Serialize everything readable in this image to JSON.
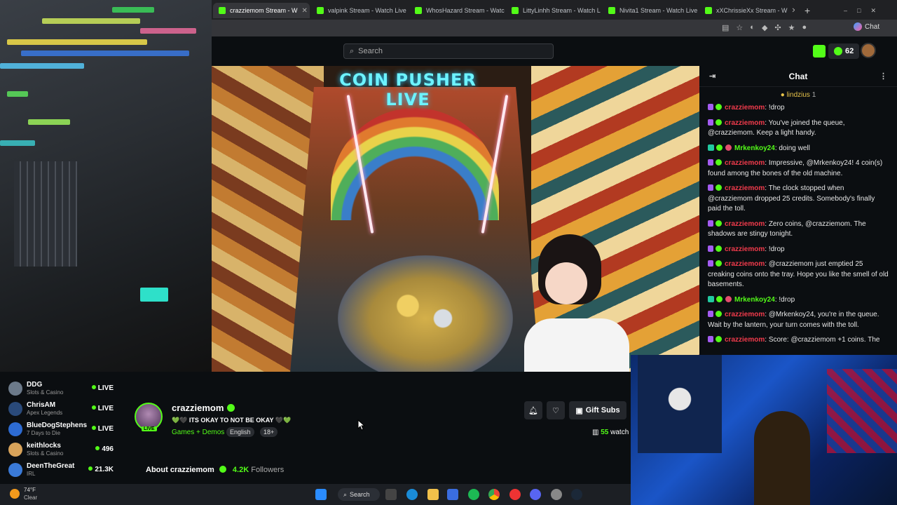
{
  "browser": {
    "tabs": [
      {
        "label": "crazziemom Stream - W",
        "active": true
      },
      {
        "label": "valpink Stream - Watch Live"
      },
      {
        "label": "WhosHazard Stream - Watc"
      },
      {
        "label": "LittyLinhh Stream - Watch L"
      },
      {
        "label": "Nivita1 Stream - Watch Live"
      },
      {
        "label": "xXChrissieXx Stream - W"
      }
    ],
    "chat_button": "Chat"
  },
  "header": {
    "search_placeholder": "Search",
    "kicks_count": "62"
  },
  "video": {
    "overlay_title": "COIN PUSHER LIVE"
  },
  "chat": {
    "title": "Chat",
    "pinned_user": "lindzius",
    "pinned_count": "1",
    "messages": [
      {
        "user": "crazziemom",
        "color": "#f23b4c",
        "text": "!drop"
      },
      {
        "user": "crazziemom",
        "color": "#f23b4c",
        "text": "You've joined the queue, @crazziemom. Keep a light handy."
      },
      {
        "user": "Mrkenkoy24",
        "color": "#53fc18",
        "text": "doing well"
      },
      {
        "user": "crazziemom",
        "color": "#f23b4c",
        "text": "Impressive, @Mrkenkoy24! 4 coin(s) found among the bones of the old machine."
      },
      {
        "user": "crazziemom",
        "color": "#f23b4c",
        "text": "The clock stopped when @crazziemom dropped 25 credits. Somebody's finally paid the toll."
      },
      {
        "user": "crazziemom",
        "color": "#f23b4c",
        "text": "Zero coins, @crazziemom. The shadows are stingy tonight."
      },
      {
        "user": "crazziemom",
        "color": "#f23b4c",
        "text": "!drop"
      },
      {
        "user": "crazziemom",
        "color": "#f23b4c",
        "text": "@crazziemom just emptied 25 creaking coins onto the tray. Hope you like the smell of old basements."
      },
      {
        "user": "Mrkenkoy24",
        "color": "#53fc18",
        "text": "!drop"
      },
      {
        "user": "crazziemom",
        "color": "#f23b4c",
        "text": "@Mrkenkoy24, you're in the queue. Wait by the lantern, your turn comes with the toll."
      },
      {
        "user": "crazziemom",
        "color": "#f23b4c",
        "text": "Score: @crazziemom +1 coins. The"
      }
    ]
  },
  "sidebar": {
    "items": [
      {
        "name": "DDG",
        "category": "Slots & Casino",
        "status": "LIVE"
      },
      {
        "name": "ChrisAM",
        "category": "Apex Legends",
        "status": "LIVE"
      },
      {
        "name": "BlueDogStephens",
        "category": "7 Days to Die",
        "status": "LIVE"
      },
      {
        "name": "keithlocks",
        "category": "Slots & Casino",
        "status": "496"
      },
      {
        "name": "DeenTheGreat",
        "category": "IRL",
        "status": "21.3K"
      }
    ]
  },
  "streamer": {
    "name": "crazziemom",
    "live_badge": "LIVE",
    "title": "💚🖤 ITS OKAY TO NOT BE OKAY 🖤💚",
    "category": "Games + Demos",
    "tags": [
      "English",
      "18+"
    ],
    "gift_subs_label": "Gift Subs",
    "watchers_count": "55",
    "watchers_label": "watch",
    "about_label": "About crazziemom",
    "followers_count": "4.2K",
    "followers_label": "Followers"
  },
  "taskbar": {
    "weather_temp": "74°F",
    "weather_cond": "Clear",
    "search_label": "Search"
  },
  "colors": {
    "accent": "#53fc18",
    "background": "#0b0e11"
  }
}
